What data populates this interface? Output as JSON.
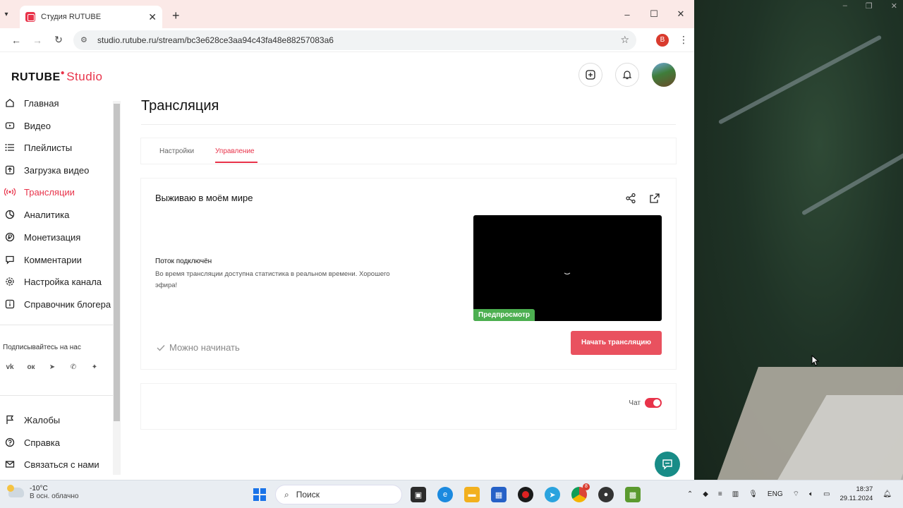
{
  "browser": {
    "tab_title": "Студия RUTUBE",
    "url": "studio.rutube.ru/stream/bc3e628ce3aa94c43fa48e88257083a6",
    "profile_letter": "В"
  },
  "app": {
    "logo_main": "RUTUBE",
    "logo_sub": "Studio"
  },
  "sidebar": {
    "items": [
      {
        "label": "Главная"
      },
      {
        "label": "Видео"
      },
      {
        "label": "Плейлисты"
      },
      {
        "label": "Загрузка видео"
      },
      {
        "label": "Трансляции"
      },
      {
        "label": "Аналитика"
      },
      {
        "label": "Монетизация"
      },
      {
        "label": "Комментарии"
      },
      {
        "label": "Настройка канала"
      },
      {
        "label": "Справочник блогера"
      }
    ],
    "follow_label": "Подписывайтесь на нас",
    "bottom_items": [
      {
        "label": "Жалобы"
      },
      {
        "label": "Справка"
      },
      {
        "label": "Связаться с нами"
      }
    ]
  },
  "main": {
    "title": "Трансляция",
    "tabs": [
      {
        "label": "Настройки"
      },
      {
        "label": "Управление"
      }
    ],
    "stream": {
      "title": "Выживаю в моём мире",
      "status_heading": "Поток подключён",
      "status_text": "Во время трансляции доступна статистика в реальном времени. Хорошего эфира!",
      "preview_badge": "Предпросмотр",
      "ready_label": "Можно начинать",
      "start_button": "Начать трансляцию"
    },
    "chat": {
      "label": "Чат",
      "enabled": true
    }
  },
  "taskbar": {
    "weather_temp": "-10°C",
    "weather_desc": "В осн. облачно",
    "search_placeholder": "Поиск",
    "lang": "ENG",
    "time": "18:37",
    "date": "29.11.2024",
    "chrome_badge": "8"
  },
  "colors": {
    "accent": "#e8334a",
    "preview_badge": "#4caf50",
    "fab": "#188c87"
  }
}
